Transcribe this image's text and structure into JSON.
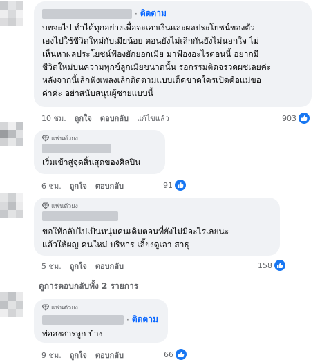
{
  "comments": [
    {
      "follow": "ติดตาม",
      "text": "บทจะไป ทำได้ทุกอย่างเพื่อจะเอาเงินและผลประโยชน์ของตัว\nเองไปใช้ชีวิตใหม่กับเมียน้อย ตอนยังไม่เลิกกันยังไม่นอกใจ ไม่\nเห็นหาผลประโยชน์ฟ้องยักยอกเมีย มาฟ้องอะไรตอนนี้ อยากมี\nชีวิตใหม่บนความทุกข์ลูกเมียขนาดนั้น รอกรรมติดจรวดผชเลยค่ะ\nหลังจากนี้เลิกฟังเพลงเลิกติดตามแบบเด็ดขาดใครเปิดคือแม่ขอ\nด่าค่ะ อย่าสนับสนุนผู้ชายแบบนี้",
      "time": "10 ชม.",
      "like": "ถูกใจ",
      "reply": "ตอบกลับ",
      "edited": "แก้ไขแล้ว",
      "reactions": "903"
    },
    {
      "badge": "แฟนตัวยง",
      "text": "เริ่มเข้าสู่จุดสิ้นสุดของศิลปิน",
      "time": "6 ชม.",
      "like": "ถูกใจ",
      "reply": "ตอบกลับ",
      "reactions": "91"
    },
    {
      "badge": "แฟนตัวยง",
      "text": "ขอให้กลับไปเป็นหนุ่มคนเดิมตอนที่ยังไม่มีอะไรเลยนะ\nแล้วให้ผญ คนใหม่ บริหาร เลี้ยงดูเอา สาธุ",
      "time": "5 ชม.",
      "like": "ถูกใจ",
      "reply": "ตอบกลับ",
      "reactions": "158"
    },
    {
      "badge": "แฟนตัวยง",
      "follow": "ติดตาม",
      "text": "พ่อสงสารลูก บ้าง",
      "time": "9 ชม.",
      "like": "ถูกใจ",
      "reply": "ตอบกลับ",
      "reactions": "66"
    }
  ],
  "view_replies": "ดูการตอบกลับทั้ง 2 รายการ",
  "colors": {
    "bubble": "#f0f2f5",
    "link": "#0866ff",
    "muted": "#65676b",
    "like": "#1877f2"
  },
  "icons": {
    "like": "like-thumb-icon",
    "badge": "diamond-badge-icon"
  }
}
